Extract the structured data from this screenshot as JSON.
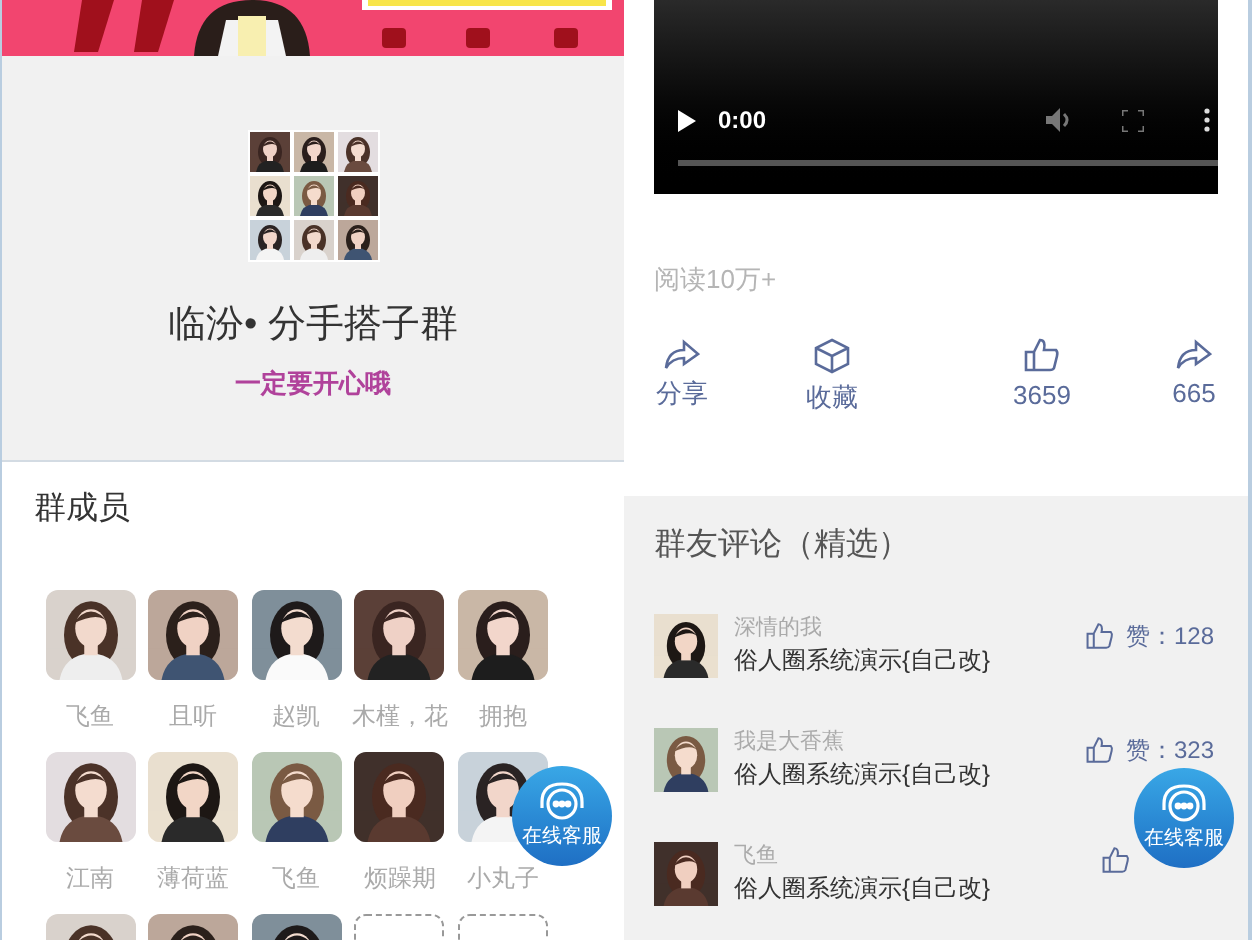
{
  "group": {
    "name": "临汾• 分手搭子群",
    "slogan": "一定要开心哦"
  },
  "members": {
    "title": "群成员",
    "items": [
      {
        "kind": "picture",
        "name": "飞鱼"
      },
      {
        "kind": "picture",
        "name": "且听"
      },
      {
        "kind": "picture",
        "name": "赵凯"
      },
      {
        "kind": "picture",
        "name": "木槿，花"
      },
      {
        "kind": "picture",
        "name": "拥抱"
      },
      {
        "kind": "picture",
        "name": "江南"
      },
      {
        "kind": "picture",
        "name": "薄荷蓝"
      },
      {
        "kind": "picture",
        "name": "飞鱼"
      },
      {
        "kind": "picture",
        "name": "烦躁期"
      },
      {
        "kind": "picture",
        "name": "小丸子"
      },
      {
        "kind": "picture"
      },
      {
        "kind": "picture"
      },
      {
        "kind": "picture"
      },
      {
        "kind": "empty"
      },
      {
        "kind": "empty"
      }
    ]
  },
  "video": {
    "time": "0:00"
  },
  "reads": "阅读10万+",
  "actions": [
    {
      "kind": "share",
      "label": "分享"
    },
    {
      "kind": "box",
      "label": "收藏"
    },
    {
      "kind": "like",
      "label": "3659"
    },
    {
      "kind": "share",
      "label": "665"
    }
  ],
  "comments": {
    "title": "群友评论（精选）",
    "items": [
      {
        "user": "深情的我",
        "text": "俗人圈系统演示{自己改}",
        "likes": "赞：128"
      },
      {
        "user": "我是大香蕉",
        "text": "俗人圈系统演示{自己改}",
        "likes": "赞：323"
      },
      {
        "user": "飞鱼",
        "text": "俗人圈系统演示{自己改}"
      }
    ]
  },
  "service_buttons": [
    {
      "label": "在线客服"
    },
    {
      "label": "在线客服"
    }
  ]
}
